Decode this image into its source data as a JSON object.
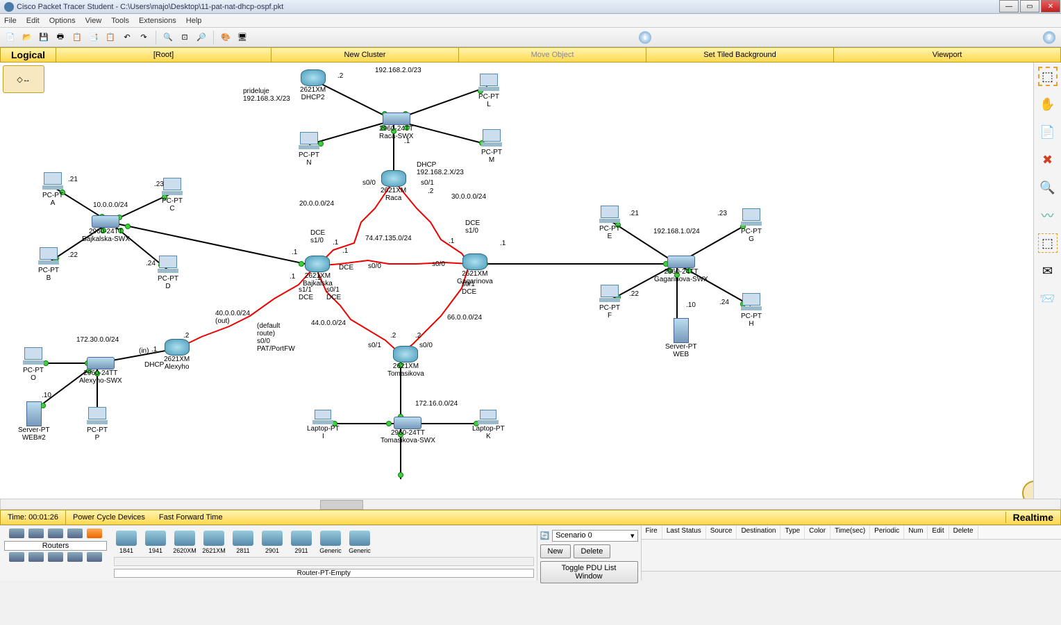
{
  "titlebar": {
    "text": "Cisco Packet Tracer Student - C:\\Users\\majo\\Desktop\\11-pat-nat-dhcp-ospf.pkt"
  },
  "menu": {
    "file": "File",
    "edit": "Edit",
    "options": "Options",
    "view": "View",
    "tools": "Tools",
    "extensions": "Extensions",
    "help": "Help"
  },
  "navbar": {
    "logical": "Logical",
    "root": "[Root]",
    "newcluster": "New Cluster",
    "move": "Move Object",
    "tiled": "Set Tiled Background",
    "viewport": "Viewport"
  },
  "timebar": {
    "time": "Time: 00:01:26",
    "pcd": "Power Cycle Devices",
    "fft": "Fast Forward Time",
    "realtime": "Realtime"
  },
  "devcat": {
    "label": "Routers",
    "selected": "Router-PT-Empty"
  },
  "devices": [
    {
      "label": "1841"
    },
    {
      "label": "1941"
    },
    {
      "label": "2620XM"
    },
    {
      "label": "2621XM"
    },
    {
      "label": "2811"
    },
    {
      "label": "2901"
    },
    {
      "label": "2911"
    },
    {
      "label": "Generic"
    },
    {
      "label": "Generic"
    }
  ],
  "scenario": {
    "selected": "Scenario 0",
    "new": "New",
    "delete": "Delete",
    "toggle": "Toggle PDU List Window"
  },
  "pducols": {
    "fire": "Fire",
    "last": "Last Status",
    "source": "Source",
    "dest": "Destination",
    "type": "Type",
    "color": "Color",
    "timesec": "Time(sec)",
    "periodic": "Periodic",
    "num": "Num",
    "edit": "Edit",
    "del": "Delete"
  },
  "helpicon": {
    "i": "i",
    "q": "?"
  },
  "nodes": {
    "dhcp2": "2621XM\nDHCP2",
    "raca_swx": "2960-24TT\nRaca-SWX",
    "raca": "2621XM\nRaca",
    "pcl": "PC-PT\nL",
    "pcm": "PC-PT\nM",
    "pcn": "PC-PT\nN",
    "pca": "PC-PT\nA",
    "pcb": "PC-PT\nB",
    "pcc": "PC-PT\nC",
    "pcd": "PC-PT\nD",
    "bajk_swx": "2960-24TT\nBajkalska-SWX",
    "bajkalska": "2621XM\nBajkalska",
    "gagarinova": "2621XM\nGagarinova",
    "gag_swx": "2960-24TT\nGagarinova-SWX",
    "pce": "PC-PT\nE",
    "pcf": "PC-PT\nF",
    "pcg": "PC-PT\nG",
    "pch": "PC-PT\nH",
    "web": "Server-PT\nWEB",
    "tomasikova": "2621XM\nTomasikova",
    "tom_swx": "2960-24TT\nTomasikova-SWX",
    "li": "Laptop-PT\nI",
    "lk": "Laptop-PT\nK",
    "alexyho": "2621XM\nAlexyho",
    "alex_swx": "2960-24TT\nAlexyho-SWX",
    "pco": "PC-PT\nO",
    "pcp": "PC-PT\nP",
    "web2": "Server-PT\nWEB#2"
  },
  "labels": {
    "prideluje": "prideluje\n192.168.3.X/23",
    "net_192_168_2": "192.168.2.0/23",
    "dhcp_192": "DHCP\n192.168.2.X/23",
    "net_20": "20.0.0.0/24",
    "net_30": "30.0.0.0/24",
    "net_74": "74.47.135.0/24",
    "net_44": "44.0.0.0/24",
    "net_66": "66.0.0.0/24",
    "net_40": "40.0.0.0/24\n(out)",
    "net_172_30": "172.30.0.0/24",
    "net_10": "10.0.0.0/24",
    "net_192_168_1": "192.168.1.0/24",
    "net_172_16": "172.16.0.0/24",
    "default_route": "(default\nroute)\ns0/0\nPAT/PortFW",
    "dce_s10_b": "DCE\ns1/0",
    "dce_s10_g": "DCE\ns1/0",
    "s01_raca": "s0/1",
    "s00_bajk": "s0/0",
    "dce_bajk": "DCE",
    "s11_dce": "s1/1\nDCE",
    "s01_dce": "s0/1\nDCE",
    "s00_gag": "s0/0",
    "s01_dce_g": "s0/1\nDCE",
    "s01_tom": "s0/1",
    "s00_tom": "s0/0",
    "in": "(in)",
    "dhcp": "DHCP",
    "d21_a": ".21",
    "d22_b": ".22",
    "d23_c": ".23",
    "d24_d": ".24",
    "d21_e": ".21",
    "d22_f": ".22",
    "d23_g": ".23",
    "d24_h": ".24",
    "d10_web": ".10",
    "d10_web2": ".10",
    "d2_dhcp2": ".2",
    "d1_racaswx": ".1",
    "d1_bajk_r": ".1",
    "d1_bajk_up": ".1",
    "d1_bajk_down": ".1",
    "d2_gag_up": ".2",
    "d1_gag": ".1",
    "d1_gag_r": ".1",
    "d2_tom_l": ".2",
    "d2_tom_r": ".2",
    "d1_alex": ".1",
    "d2_alex": ".2"
  }
}
